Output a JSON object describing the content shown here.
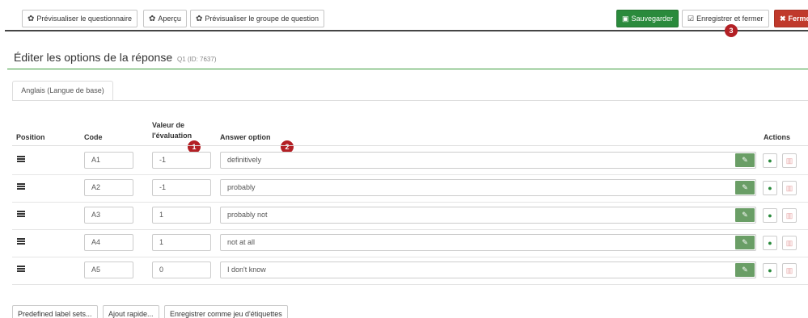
{
  "toolbar": {
    "preview_survey": "Prévisualiser le questionnaire",
    "overview": "Aperçu",
    "preview_group": "Prévisualiser le groupe de question",
    "save": "Sauvegarder",
    "save_close": "Enregistrer et fermer",
    "close": "Ferme"
  },
  "badges": {
    "one": "1",
    "two": "2",
    "three": "3"
  },
  "title": {
    "main": "Éditer les options de la réponse",
    "sub": "Q1 (ID: 7637)"
  },
  "tab": {
    "label": "Anglais (Langue de base)"
  },
  "table": {
    "headers": {
      "position": "Position",
      "code": "Code",
      "assessment_line1": "Valeur de",
      "assessment_line2": "l'évaluation",
      "answer": "Answer option",
      "actions": "Actions"
    },
    "rows": [
      {
        "code": "A1",
        "assessment": "-1",
        "answer": "definitively"
      },
      {
        "code": "A2",
        "assessment": "-1",
        "answer": "probably"
      },
      {
        "code": "A3",
        "assessment": "1",
        "answer": "probably not"
      },
      {
        "code": "A4",
        "assessment": "1",
        "answer": "not at all"
      },
      {
        "code": "A5",
        "assessment": "0",
        "answer": "I don't know"
      }
    ]
  },
  "bottom": {
    "predefined": "Predefined label sets...",
    "quick_add": "Ajout rapide...",
    "save_labelset": "Enregistrer comme jeu d'étiquettes"
  },
  "colors": {
    "save": "#2a8a3c",
    "close": "#c0392b",
    "badge": "#b32025",
    "edit": "#6a9e66"
  }
}
